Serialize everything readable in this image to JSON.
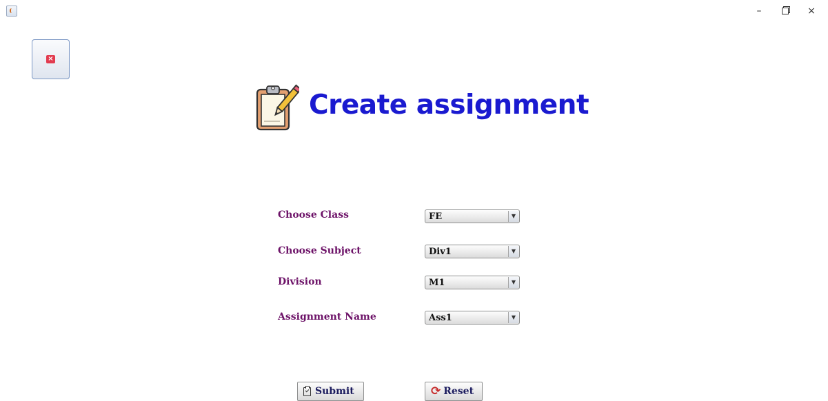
{
  "window": {
    "icons": {
      "app": "java-app-icon",
      "minimize": "minimize-icon",
      "maximize": "maximize-icon",
      "close": "close-icon"
    },
    "close_glyph": "×",
    "min_glyph": "–"
  },
  "close_button": {
    "icon": "red-x-icon",
    "glyph": "×"
  },
  "header": {
    "icon": "clipboard-pencil-icon",
    "title": "Create assignment"
  },
  "form": {
    "fields": [
      {
        "label": "Choose Class",
        "value": "FE"
      },
      {
        "label": "Choose Subject",
        "value": "Div1"
      },
      {
        "label": "Division",
        "value": "M1"
      },
      {
        "label": "Assignment Name",
        "value": "Ass1"
      }
    ],
    "dropdown_arrow": "▼"
  },
  "actions": {
    "submit": {
      "label": "Submit",
      "icon": "clipboard-check-icon"
    },
    "reset": {
      "label": "Reset",
      "icon": "refresh-icon",
      "glyph": "⟳"
    }
  },
  "colors": {
    "title": "#1a1ad0",
    "label": "#6d1368",
    "close_accent": "#e23b4f"
  }
}
